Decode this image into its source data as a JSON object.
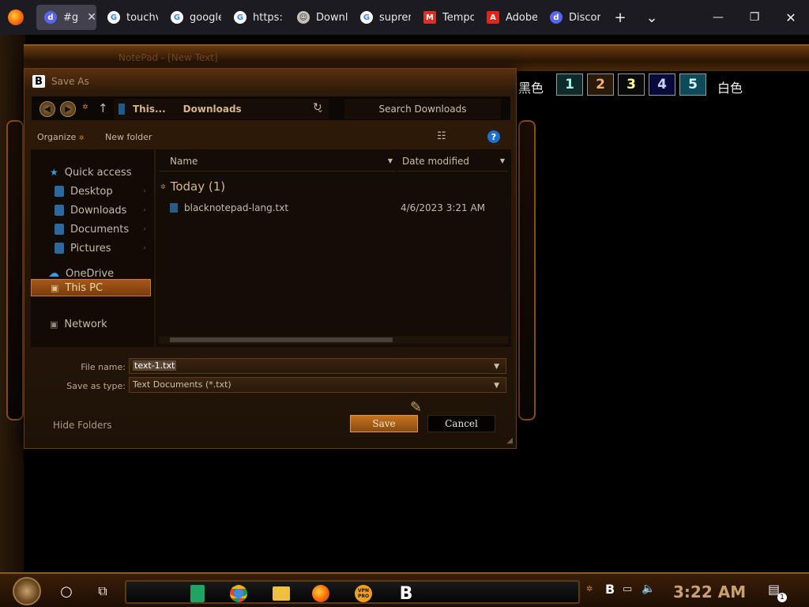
{
  "browser": {
    "tabs": [
      {
        "label": "#ge",
        "icon": "discord-icon",
        "active": true
      },
      {
        "label": "touchv",
        "icon": "google-icon"
      },
      {
        "label": "google",
        "icon": "google-icon"
      },
      {
        "label": "https:",
        "icon": "google-icon"
      },
      {
        "label": "Downlo",
        "icon": "downloader-icon"
      },
      {
        "label": "supren",
        "icon": "google-icon"
      },
      {
        "label": "Tempo",
        "icon": "gmail-icon"
      },
      {
        "label": "Adobe",
        "icon": "adobe-icon"
      },
      {
        "label": "Discor",
        "icon": "discord-icon"
      }
    ],
    "close_glyph": "✕",
    "new_tab_glyph": "+",
    "list_tabs_glyph": "⌄",
    "minimize_glyph": "—",
    "restore_glyph": "❐",
    "close_window_glyph": "✕"
  },
  "notepad": {
    "title": "NotePad - [New Text]",
    "color_black_label": "黑色",
    "color_white_label": "白色",
    "color_boxes": [
      {
        "num": "1",
        "bg": "#0e2a2a",
        "fg": "#a8f0e0"
      },
      {
        "num": "2",
        "bg": "#2a1a0a",
        "fg": "#f0b070"
      },
      {
        "num": "3",
        "bg": "#0a0a0a",
        "fg": "#ffffa0"
      },
      {
        "num": "4",
        "bg": "#0a0a3a",
        "fg": "#c8d0ff"
      },
      {
        "num": "5",
        "bg": "#0e4a5a",
        "fg": "#d8f8ff"
      }
    ]
  },
  "dialog": {
    "title": "Save As",
    "path_root": "This...",
    "path_current": "Downloads",
    "search_placeholder": "Search Downloads",
    "organize_label": "Organize",
    "new_folder_label": "New folder",
    "help_label": "?",
    "nav": {
      "quick_access": "Quick access",
      "desktop": "Desktop",
      "downloads": "Downloads",
      "documents": "Documents",
      "pictures": "Pictures",
      "onedrive": "OneDrive",
      "this_pc": "This PC",
      "network": "Network"
    },
    "columns": {
      "name": "Name",
      "date_modified": "Date modified"
    },
    "group_label": "Today (1)",
    "files": [
      {
        "name": "blacknotepad-lang.txt",
        "date": "4/6/2023 3:21 AM"
      }
    ],
    "file_name_label": "File name:",
    "file_name_value": "text-1.txt",
    "save_type_label": "Save as type:",
    "save_type_value": "Text Documents (*.txt)",
    "hide_folders_label": "Hide Folders",
    "save_label": "Save",
    "cancel_label": "Cancel"
  },
  "taskbar": {
    "clock": "3:22 AM",
    "notification_count": "1",
    "apps": [
      "sheets-icon",
      "chrome-icon",
      "file-explorer-icon",
      "firefox-icon",
      "vpn-pro-icon",
      "blacknotepad-icon"
    ],
    "vpn_label": "VPN PRO",
    "b_label": "B"
  },
  "colors": {
    "accent": "#c47420",
    "brass": "#8a5a1e",
    "dialog_bg": "#1e1208"
  }
}
